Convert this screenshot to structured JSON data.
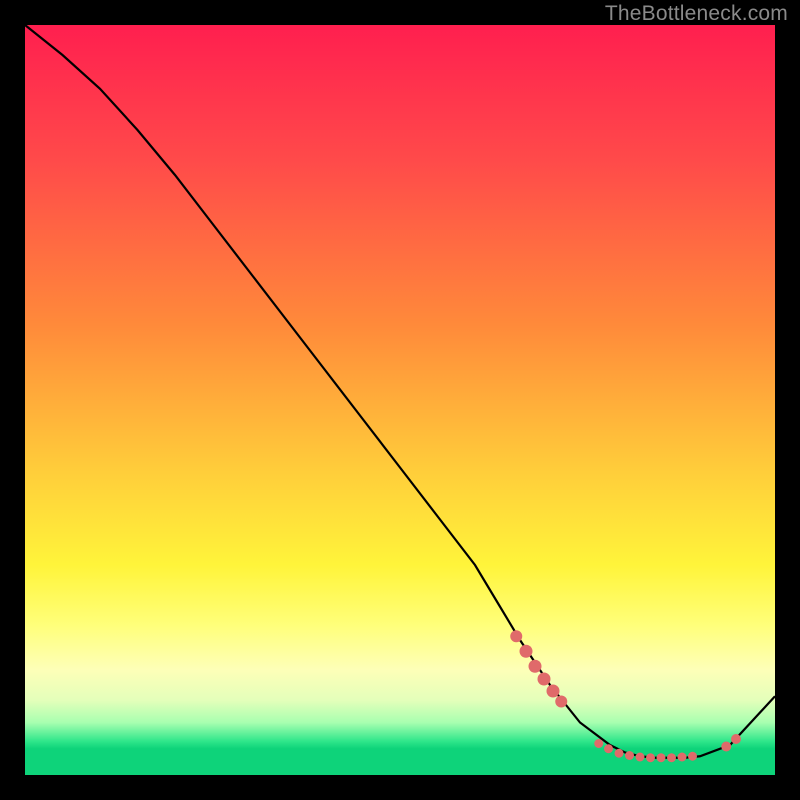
{
  "watermark": "TheBottleneck.com",
  "chart_data": {
    "type": "line",
    "title": "",
    "xlabel": "",
    "ylabel": "",
    "xlim": [
      0,
      100
    ],
    "ylim": [
      0,
      100
    ],
    "grid": false,
    "series": [
      {
        "name": "curve",
        "x": [
          0,
          5,
          10,
          15,
          20,
          25,
          30,
          35,
          40,
          45,
          50,
          55,
          60,
          63,
          66,
          70,
          74,
          78,
          80,
          82,
          84,
          86,
          88,
          90,
          94,
          100
        ],
        "y": [
          100,
          96,
          91.5,
          86,
          80,
          73.5,
          67,
          60.5,
          54,
          47.5,
          41,
          34.5,
          28,
          23,
          18,
          12,
          7,
          4,
          3,
          2.5,
          2.3,
          2.3,
          2.3,
          2.5,
          4,
          10.5
        ]
      }
    ],
    "markers": {
      "name": "highlighted-points",
      "color": "#e06a6a",
      "radius_small": 4.5,
      "radius_large": 6,
      "points": [
        {
          "x": 65.5,
          "y": 18.5,
          "r": 6.0
        },
        {
          "x": 66.8,
          "y": 16.5,
          "r": 6.5
        },
        {
          "x": 68.0,
          "y": 14.5,
          "r": 6.5
        },
        {
          "x": 69.2,
          "y": 12.8,
          "r": 6.5
        },
        {
          "x": 70.4,
          "y": 11.2,
          "r": 6.5
        },
        {
          "x": 71.5,
          "y": 9.8,
          "r": 6.0
        },
        {
          "x": 76.5,
          "y": 4.2,
          "r": 4.5
        },
        {
          "x": 77.8,
          "y": 3.5,
          "r": 4.5
        },
        {
          "x": 79.2,
          "y": 2.9,
          "r": 4.5
        },
        {
          "x": 80.6,
          "y": 2.6,
          "r": 4.5
        },
        {
          "x": 82.0,
          "y": 2.4,
          "r": 4.5
        },
        {
          "x": 83.4,
          "y": 2.3,
          "r": 4.5
        },
        {
          "x": 84.8,
          "y": 2.3,
          "r": 4.5
        },
        {
          "x": 86.2,
          "y": 2.3,
          "r": 4.5
        },
        {
          "x": 87.6,
          "y": 2.4,
          "r": 4.5
        },
        {
          "x": 89.0,
          "y": 2.5,
          "r": 4.5
        },
        {
          "x": 93.5,
          "y": 3.8,
          "r": 5.0
        },
        {
          "x": 94.8,
          "y": 4.8,
          "r": 5.0
        }
      ]
    }
  }
}
